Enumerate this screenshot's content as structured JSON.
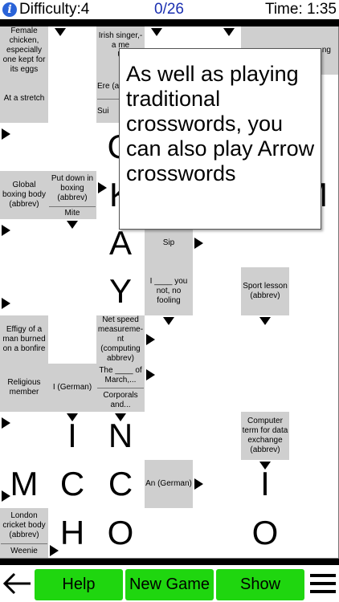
{
  "header": {
    "info_icon": "i",
    "difficulty": "Difficulty:4",
    "progress": "0/26",
    "timer": "Time: 1:35"
  },
  "grid": {
    "clues": {
      "female_chicken": "Female chicken, especially one kept for its eggs",
      "irish_singer": "Irish singer,-\na me\nU",
      "top_right_partial": "ng",
      "at_a_stretch": "At a stretch",
      "ere_partial": "Ere (a",
      "sui_partial": "Sui",
      "global_boxing": "Global boxing body (abbrev)",
      "put_down_boxing": "Put down in boxing (abbrev)",
      "mite": "Mite",
      "sip": "Sip",
      "i_you_not": "I ____ you not, no fooling",
      "sport_lesson": "Sport lesson (abbrev)",
      "effigy": "Effigy of a man burned on a bonfire",
      "net_speed": "Net speed measureme-nt (computing abbrev)",
      "religious_member": "Religious member",
      "i_german": "I (German)",
      "the_of_march": "The ____ of March,...",
      "corporals": "Corporals and...",
      "computer_term": "Computer term for data exchange (abbrev)",
      "an_german": "An (German)",
      "london_cricket": "London cricket body (abbrev)",
      "weenie": "Weenie"
    },
    "letters": {
      "r3c3": "O",
      "r4c3": "K",
      "r4c7": "M",
      "r5c3": "A",
      "r6c3": "Y",
      "r9c2": "I",
      "r9c3": "N",
      "r9c6": "I",
      "r10c1": "M",
      "r10c2": "C",
      "r10c3": "C",
      "r11c2": "H",
      "r11c3": "O",
      "r11c6": "O"
    }
  },
  "popup": {
    "message": "As well as playing traditional crosswords, you can also play Arrow crosswords"
  },
  "toolbar": {
    "back_icon": "arrow-left-icon",
    "help_label": "Help",
    "new_game_label": "New Game",
    "show_wrong_label": "Show Wrong",
    "menu_icon": "hamburger-menu-icon"
  },
  "colors": {
    "clue_cell": "#cfcfcf",
    "button_green": "#1fd60f",
    "progress_blue": "#1a2fb0",
    "info_blue": "#2a63d8"
  }
}
